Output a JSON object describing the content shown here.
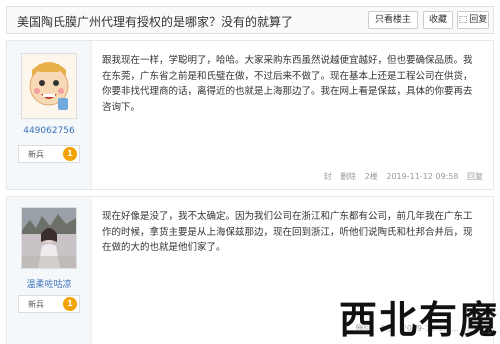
{
  "thread": {
    "title": "美国陶氏膜广州代理有授权的是哪家？没有的就算了",
    "only_author_label": "只看楼主",
    "favorite_label": "收藏",
    "reply_label": "回复"
  },
  "posts": [
    {
      "username": "449062756",
      "rank": "新兵",
      "rank_level": "1",
      "body": "跟我现在一样，学聪明了，哈哈。大家采购东西虽然说越便宜越好，但也要确保品质。我在东莞，广东省之前是和氏璧在做，不过后来不做了。现在基本上还是工程公司在供货，你要非找代理商的话，离得近的也就是上海那边了。我在网上看是保兹，具体的你要再去咨询下。",
      "footer": {
        "block": "封",
        "delete": "删除",
        "floor": "2楼",
        "time": "2019-11-12 09:58",
        "reply": "回复"
      }
    },
    {
      "username": "温柔咗咕凉",
      "rank": "新兵",
      "rank_level": "1",
      "body": "现在好像是没了，我不太确定。因为我们公司在浙江和广东都有公司，前几年我在广东工作的时候，拿货主要是从上海保兹那边，现在回到浙江，听他们说陶氏和杜邦合并后，现在做的大的也就是他们家了。",
      "footer": {
        "delete": "删除",
        "floor": "3楼",
        "time": "2019-11-12 ...",
        "reply": "回复"
      }
    }
  ],
  "watermark": "西北有魔"
}
